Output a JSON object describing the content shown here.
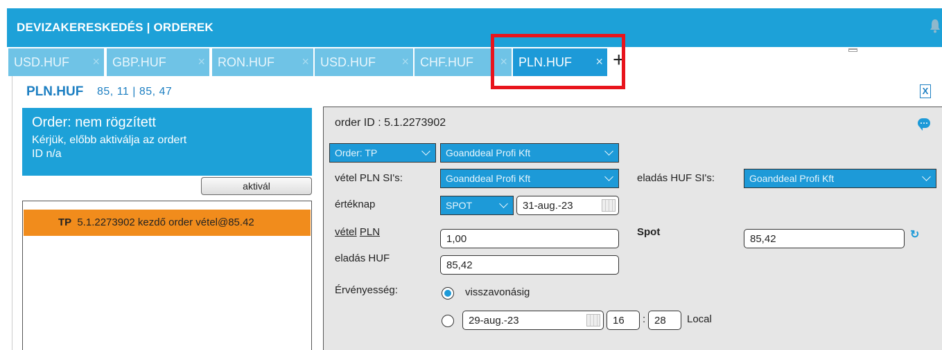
{
  "header": {
    "title": "DEVIZAKERESKEDÉS  |  ORDEREK"
  },
  "tabs": [
    {
      "label": "USD.HUF",
      "close": "×"
    },
    {
      "label": "GBP.HUF",
      "close": "×"
    },
    {
      "label": "RON.HUF",
      "close": "×"
    },
    {
      "label": "USD.HUF",
      "close": "×"
    },
    {
      "label": "CHF.HUF",
      "close": "×"
    },
    {
      "label": "PLN.HUF",
      "close": "×",
      "active": true
    }
  ],
  "add_tab": "+",
  "pair": {
    "name": "PLN.HUF",
    "rate": "85, 11 | 85, 47"
  },
  "export_icon": "X",
  "status": {
    "title": "Order: nem rögzített",
    "line1": "Kérjük, előbb aktiválja az ordert",
    "line2": "ID n/a",
    "activate_label": "aktivál"
  },
  "order_list": [
    {
      "type": "TP",
      "text": "5.1.2273902 kezdő order vétel@85.42"
    }
  ],
  "form": {
    "order_id_label": "order ID : 5.1.2273902",
    "order_type": "Order: TP",
    "client": "Goanddeal Profi Kft",
    "buy_si_label": "vétel PLN SI's:",
    "buy_si_value": "Goanddeal Profi Kft",
    "sell_si_label": "eladás HUF SI's:",
    "sell_si_value": "Goanddeal Profi Kft",
    "value_date_label": "értéknap",
    "value_date_type": "SPOT",
    "value_date": "31-aug.-23",
    "buy_label": "vétel",
    "buy_ccy": "PLN",
    "buy_amount": "1,00",
    "spot_label": "Spot",
    "spot_value": "85,42",
    "sell_label": "eladás HUF",
    "sell_amount": "85,42",
    "validity_label": "Érvényesség:",
    "validity_option1": "visszavonásig",
    "validity_date": "29-aug.-23",
    "validity_hour": "16",
    "validity_minute": "28",
    "timezone": "Local"
  },
  "colors": {
    "accent": "#1da1d8",
    "tab_inactive": "#6fc3e6",
    "order_row": "#f18c1c",
    "highlight": "#e8141c"
  }
}
